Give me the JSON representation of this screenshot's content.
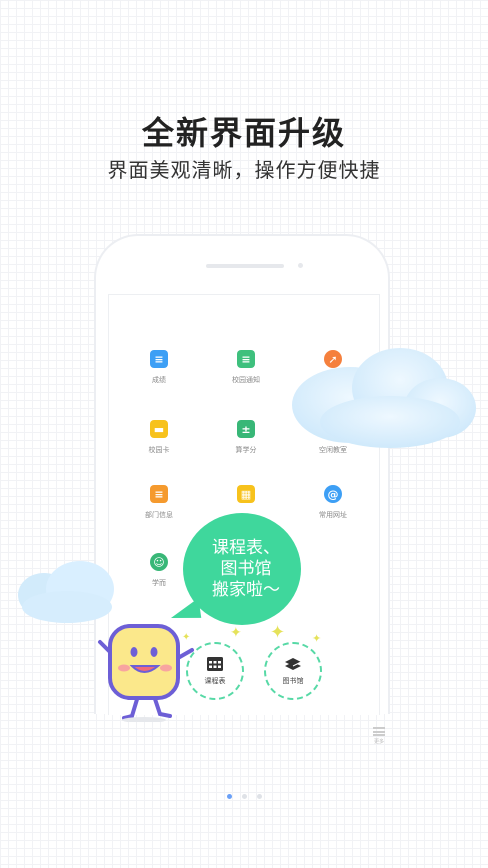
{
  "headline": "全新界面升级",
  "subline": "界面美观清晰，操作方便快捷",
  "apps": [
    {
      "label": "成绩",
      "icon": "grades-icon",
      "color": "#3d9ff5",
      "glyph": "≡"
    },
    {
      "label": "校园通知",
      "icon": "notice-icon",
      "color": "#3ec07d",
      "glyph": "≡"
    },
    {
      "label": "...",
      "icon": "rocket-icon",
      "color": "#f5803d",
      "glyph": "➚"
    },
    {
      "label": "校园卡",
      "icon": "card-icon",
      "color": "#f7c21c",
      "glyph": "▬"
    },
    {
      "label": "算学分",
      "icon": "calc-icon",
      "color": "#38b777",
      "glyph": "±"
    },
    {
      "label": "空闲教室",
      "icon": "classroom-icon",
      "color": "#3ec07d",
      "glyph": "⌂"
    },
    {
      "label": "部门信息",
      "icon": "dept-icon",
      "color": "#f59a2e",
      "glyph": "≡"
    },
    {
      "label": "",
      "icon": "calendar-icon",
      "color": "#f7c21c",
      "glyph": "▦"
    },
    {
      "label": "常用网址",
      "icon": "link-icon",
      "color": "#3d9ff5",
      "glyph": "@"
    },
    {
      "label": "学而",
      "icon": "study-icon",
      "color": "#38b777",
      "glyph": "☺"
    }
  ],
  "bubble_lines": [
    "课程表、",
    "图书馆",
    "搬家啦～"
  ],
  "buttons": {
    "schedule": "课程表",
    "library": "图书馆"
  },
  "tabbar_label": "更多",
  "pager": {
    "count": 3,
    "active": 0
  },
  "colors": {
    "accent": "#3fd79c",
    "cloud": "#d8efff",
    "mascot": "#fbe88b"
  }
}
